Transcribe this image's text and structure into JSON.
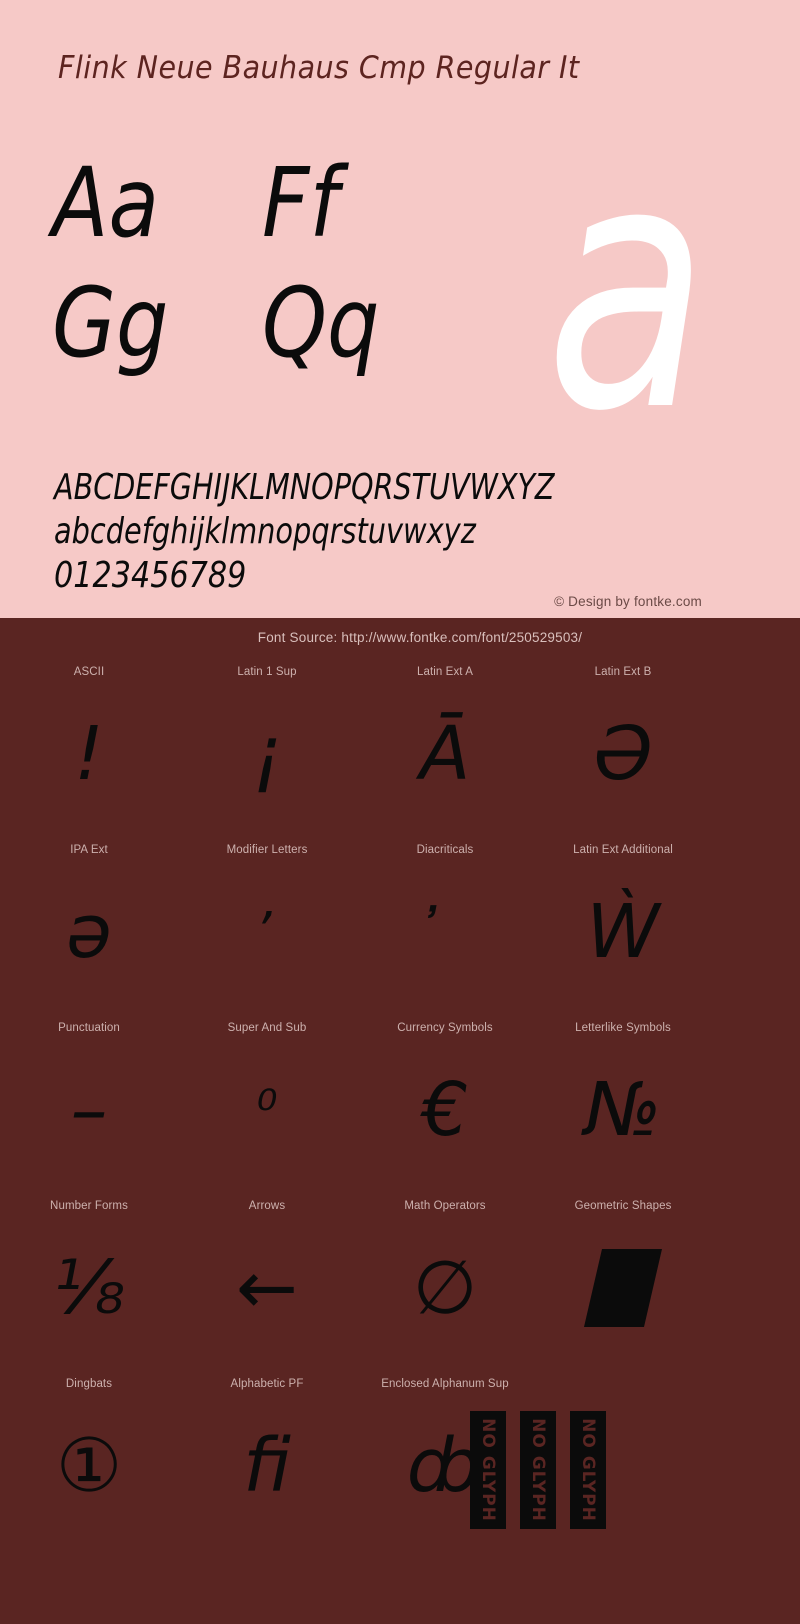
{
  "specimen": {
    "title": "Flink Neue Bauhaus Cmp Regular It",
    "big_glyph": "a",
    "letter_pairs": [
      "Aa",
      "Ff",
      "Gg",
      "Qq"
    ],
    "uppercase": "ABCDEFGHIJKLMNOPQRSTUVWXYZ",
    "lowercase": "abcdefghijklmnopqrstuvwxyz",
    "digits": "0123456789",
    "copyright": "© Design by fontke.com",
    "colors": {
      "panel_background": "#f6c9c7",
      "glyph": "#0b0b0b",
      "title": "#5d2420",
      "big_glyph": "#ffffff"
    }
  },
  "coverage": {
    "source_label": "Font Source: http://www.fontke.com/font/250529503/",
    "colors": {
      "panel_background": "#5a2522",
      "label": "#cdb1ae",
      "glyph": "#0b0b0b"
    },
    "rows": [
      [
        {
          "label": "ASCII",
          "sample": "!"
        },
        {
          "label": "Latin 1 Sup",
          "sample": "¡"
        },
        {
          "label": "Latin Ext A",
          "sample": "Ā"
        },
        {
          "label": "Latin Ext B",
          "sample": "Ə"
        }
      ],
      [
        {
          "label": "IPA Ext",
          "sample": "ə"
        },
        {
          "label": "Modifier Letters",
          "sample": "ʼ"
        },
        {
          "label": "Diacriticals",
          "sample": "̓"
        },
        {
          "label": "Latin Ext Additional",
          "sample": "Ẁ"
        }
      ],
      [
        {
          "label": "Punctuation",
          "sample": "–"
        },
        {
          "label": "Super And Sub",
          "sample": "⁰"
        },
        {
          "label": "Currency Symbols",
          "sample": "€"
        },
        {
          "label": "Letterlike Symbols",
          "sample": "№"
        }
      ],
      [
        {
          "label": "Number Forms",
          "sample": "⅛"
        },
        {
          "label": "Arrows",
          "sample": "←"
        },
        {
          "label": "Math Operators",
          "sample": "∅"
        },
        {
          "label": "Geometric Shapes",
          "sample": "▰"
        }
      ],
      [
        {
          "label": "Dingbats",
          "sample": "①"
        },
        {
          "label": "Alphabetic PF",
          "sample": "ﬁ"
        },
        {
          "label": "Enclosed Alphanum Sup",
          "sample": "ȸ"
        }
      ]
    ],
    "no_glyph_label": "NO GLYPH",
    "no_glyph_count": 3
  }
}
